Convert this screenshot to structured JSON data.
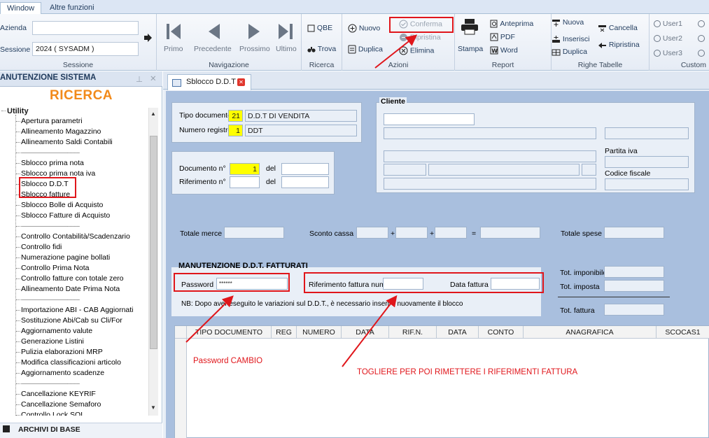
{
  "menubar": {
    "tabs": [
      "Window",
      "Altre funzioni"
    ]
  },
  "ribbon": {
    "sessione": {
      "azienda_label": "Azienda",
      "sessione_label": "Sessione",
      "sessione_value": "2024 ( SYSADM )",
      "group": "Sessione"
    },
    "navigazione": {
      "items": [
        "Primo",
        "Precedente",
        "Prossimo",
        "Ultimo"
      ],
      "group": "Navigazione"
    },
    "ricerca": {
      "qbe": "QBE",
      "trova": "Trova",
      "group": "Ricerca"
    },
    "azioni": {
      "nuovo": "Nuovo",
      "duplica": "Duplica",
      "conferma": "Conferma",
      "ripristina": "Ripristina",
      "elimina": "Elimina",
      "group": "Azioni"
    },
    "report": {
      "stampa": "Stampa",
      "anteprima": "Anteprima",
      "pdf": "PDF",
      "word": "Word",
      "group": "Report"
    },
    "righe": {
      "nuova": "Nuova",
      "inserisci": "Inserisci",
      "duplica": "Duplica",
      "cancella": "Cancella",
      "ripristina": "Ripristina",
      "group": "Righe Tabelle"
    },
    "custom": {
      "user1": "User1",
      "user2": "User2",
      "user3": "User3",
      "group": "Custom"
    }
  },
  "sidebar": {
    "header": "ANUTENZIONE SISTEMA",
    "ricerca": "RICERCA",
    "root": "Utility",
    "items": [
      "Apertura parametri",
      "Allineamento Magazzino",
      "Allineamento Saldi Contabili",
      "------------------------------------------",
      "Sblocco prima nota",
      "Sblocco prima nota iva",
      "Sblocco D.D.T",
      "Sblocco fatture",
      "Sblocco Bolle di Acquisto",
      "Sblocco Fatture di Acquisto",
      "------------------------------------------",
      "Controllo Contabilità/Scadenzario",
      "Controllo fidi",
      "Numerazione pagine bollati",
      "Controllo Prima Nota",
      "Controllo fatture con totale zero",
      "Allineamento Date Prima Nota",
      "------------------------------------------",
      "Importazione ABI - CAB Aggiornati",
      "Sostituzione Abi/Cab su Cli/For",
      "Aggiornamento valute",
      "Generazione Listini",
      "Pulizia elaborazioni MRP",
      "Modifica classificazioni articolo",
      "Aggiornamento scadenze",
      "------------------------------------------",
      "Cancellazione KEYRIF",
      "Cancellazione Semaforo",
      "Controllo Lock SQL"
    ],
    "footer": "ARCHIVI DI BASE"
  },
  "tab": {
    "title": "Sblocco D.D.T"
  },
  "form": {
    "tipo_documento_label": "Tipo documento",
    "tipo_documento_code": "21",
    "tipo_documento_desc": "D.D.T DI VENDITA",
    "numero_registro_label": "Numero registro",
    "numero_registro_code": "1",
    "numero_registro_desc": "DDT",
    "documento_label": "Documento n°",
    "documento_value": "1",
    "del_label": "del",
    "riferimento_label": "Riferimento n°",
    "cliente_label": "Cliente",
    "partita_iva_label": "Partita iva",
    "codice_fiscale_label": "Codice fiscale",
    "totale_merce_label": "Totale merce",
    "sconto_cassa_label": "Sconto cassa",
    "plus": "+",
    "equals": "=",
    "totale_spese_label": "Totale spese",
    "manutenzione_title": "MANUTENZIONE D.D.T. FATTURATI",
    "password_label": "Password",
    "password_value": "******",
    "rif_fattura_label": "Riferimento fattura num.",
    "data_fattura_label": "Data fattura",
    "nb_text": "NB: Dopo aver eseguito le variazioni sul D.D.T., è necessario inserire nuovamente il blocco",
    "tot_imponibile_label": "Tot. imponibile",
    "tot_imposta_label": "Tot. imposta",
    "tot_fattura_label": "Tot. fattura"
  },
  "grid": {
    "columns": [
      "TIPO DOCUMENTO",
      "REG",
      "NUMERO",
      "DATA",
      "RIF.N.",
      "DATA",
      "CONTO",
      "ANAGRAFICA",
      "SCOCAS1"
    ]
  },
  "annotations": {
    "password_note": "Password CAMBIO",
    "riferimenti_note": "TOGLIERE PER POI RIMETTERE I RIFERIMENTI FATTURA"
  },
  "colors": {
    "annotation": "#e0161b",
    "ricerca": "#f28a1a",
    "highlight": "#ffff00"
  }
}
